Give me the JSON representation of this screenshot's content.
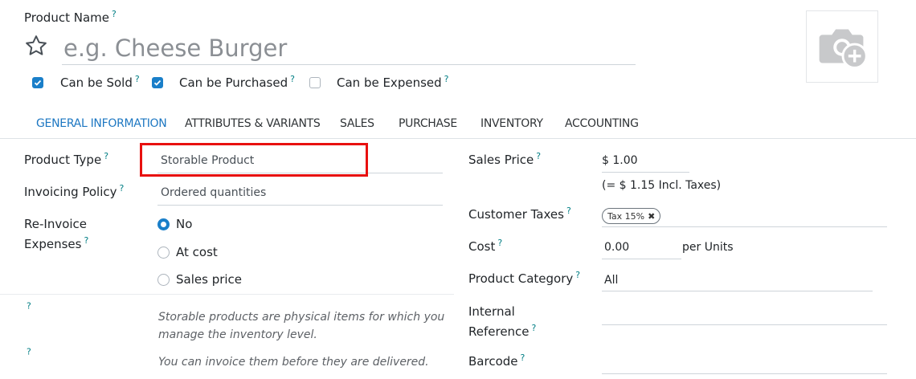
{
  "header": {
    "product_name_label": "Product Name",
    "help_mark": "?",
    "name_placeholder": "e.g. Cheese Burger"
  },
  "options": [
    {
      "label": "Can be Sold",
      "checked": true
    },
    {
      "label": "Can be Purchased",
      "checked": true
    },
    {
      "label": "Can be Expensed",
      "checked": false
    }
  ],
  "tabs": [
    {
      "label": "GENERAL INFORMATION",
      "active": true
    },
    {
      "label": "ATTRIBUTES & VARIANTS",
      "active": false
    },
    {
      "label": "SALES",
      "active": false
    },
    {
      "label": "PURCHASE",
      "active": false
    },
    {
      "label": "INVENTORY",
      "active": false
    },
    {
      "label": "ACCOUNTING",
      "active": false
    }
  ],
  "left": {
    "product_type_label": "Product Type",
    "product_type_value": "Storable Product",
    "invoicing_policy_label": "Invoicing Policy",
    "invoicing_policy_value": "Ordered quantities",
    "reinvoice_label_1": "Re-Invoice",
    "reinvoice_label_2": "Expenses",
    "reinvoice_options": [
      {
        "label": "No",
        "selected": true
      },
      {
        "label": "At cost",
        "selected": false
      },
      {
        "label": "Sales price",
        "selected": false
      }
    ],
    "help_1_line1": "Storable products are physical items for which you",
    "help_1_line2": "manage the inventory level.",
    "help_2": "You can invoice them before they are delivered."
  },
  "right": {
    "sales_price_label": "Sales Price",
    "sales_price_value": "$ 1.00",
    "incl_taxes": "(= $ 1.15 Incl. Taxes)",
    "customer_taxes_label": "Customer Taxes",
    "tax_tag": "Tax 15%",
    "cost_label": "Cost",
    "cost_value": "0.00",
    "cost_unit": "per Units",
    "product_category_label": "Product Category",
    "product_category_value": "All",
    "internal_reference_label_1": "Internal",
    "internal_reference_label_2": "Reference",
    "barcode_label": "Barcode"
  },
  "colors": {
    "accent": "#1a7fc9",
    "help_mark": "#017e84",
    "highlight_box": "#e8100f"
  }
}
